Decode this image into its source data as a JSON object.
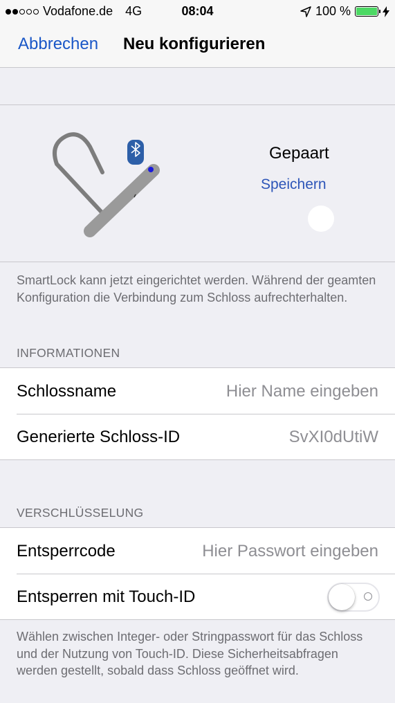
{
  "status_bar": {
    "carrier": "Vodafone.de",
    "network": "4G",
    "time": "08:04",
    "battery": "100 %",
    "battery_level": 1.0,
    "signal_bars_filled": 2,
    "signal_bars_total": 5,
    "icons": [
      "location-arrow-icon",
      "battery-icon",
      "charging-bolt-icon"
    ]
  },
  "nav": {
    "cancel_label": "Abbrechen",
    "title": "Neu konfigurieren"
  },
  "device": {
    "status": "Gepaart",
    "save_label": "Speichern",
    "icons": [
      "lock-illustration",
      "bluetooth-icon"
    ]
  },
  "intro_text": "SmartLock kann jetzt eingerichtet werden. Während der geamten Konfiguration die Verbindung zum Schloss aufrechterhalten.",
  "info_section": {
    "header": "INFORMATIONEN",
    "rows": [
      {
        "label": "Schlossname",
        "value": "Hier Name eingeben"
      },
      {
        "label": "Generierte Schloss-ID",
        "value": "SvXI0dUtiW"
      }
    ]
  },
  "encryption_section": {
    "header": "VERSCHLÜSSELUNG",
    "unlock_code_label": "Entsperrcode",
    "unlock_code_placeholder": "Hier Passwort eingeben",
    "touch_id_label": "Entsperren mit Touch-ID",
    "touch_id_enabled": false,
    "footer": "Wählen zwischen Integer- oder Stringpasswort für das Schloss und der Nutzung von Touch-ID. Diese Sicherheitsabfragen werden gestellt, sobald dass Schloss geöffnet wird."
  },
  "colors": {
    "accent": "#1a57c7",
    "background": "#efeff4",
    "secondary_text": "#6d6d72",
    "battery_green": "#4cd964",
    "bluetooth_blue": "#2d5fa8"
  }
}
